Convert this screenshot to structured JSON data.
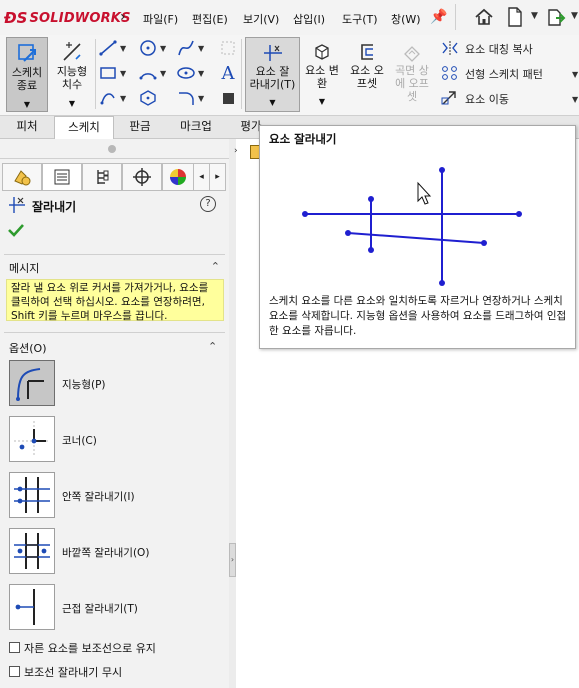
{
  "app": {
    "logo_text": "SOLIDWORKS",
    "menu": [
      "파일(F)",
      "편집(E)",
      "보기(V)",
      "삽입(I)",
      "도구(T)",
      "창(W)"
    ]
  },
  "ribbon": {
    "sketch_exit": "스케치\n종료",
    "smart_dim": "지능형\n치수",
    "trim": "요소 잘\n라내기(T)",
    "convert": "요소 변\n환",
    "offset": "요소 오\n프셋",
    "surface_offset": "곡면 상\n에 오프\n셋",
    "mirror": "요소 대칭 복사",
    "linear_pattern": "선형 스케치 패턴",
    "move": "요소 이동"
  },
  "tabs": [
    "피처",
    "스케치",
    "판금",
    "마크업",
    "평가"
  ],
  "panel": {
    "feature_title": "잘라내기",
    "message_header": "메시지",
    "message_text": "잘라 낼 요소 위로 커서를 가져가거나, 요소를 클릭하여 선택 하십시오. 요소를 연장하려면, Shift 키를 누르며 마우스를 끕니다.",
    "options_header": "옵션(O)",
    "options": [
      {
        "label": "지능형(P)",
        "selected": true
      },
      {
        "label": "코너(C)",
        "selected": false
      },
      {
        "label": "안쪽 잘라내기(I)",
        "selected": false
      },
      {
        "label": "바깥쪽 잘라내기(O)",
        "selected": false
      },
      {
        "label": "근접 잘라내기(T)",
        "selected": false
      }
    ],
    "checkboxes": [
      {
        "label": "자른 요소를 보조선으로 유지",
        "checked": false
      },
      {
        "label": "보조선 잘라내기 무시",
        "checked": false
      }
    ]
  },
  "tooltip": {
    "title": "요소 잘라내기",
    "description": "스케치 요소를 다른 요소와 일치하도록 자르거나 연장하거나 스케치 요소를 삭제합니다. 지능형 옵션을 사용하여 요소를 드래그하여 인접한 요소를 자릅니다."
  },
  "colors": {
    "brand": "#c8102e",
    "sketch_line": "#1f1fd0",
    "message_bg": "#ffff9c",
    "ok_check": "#2e9b2e"
  }
}
